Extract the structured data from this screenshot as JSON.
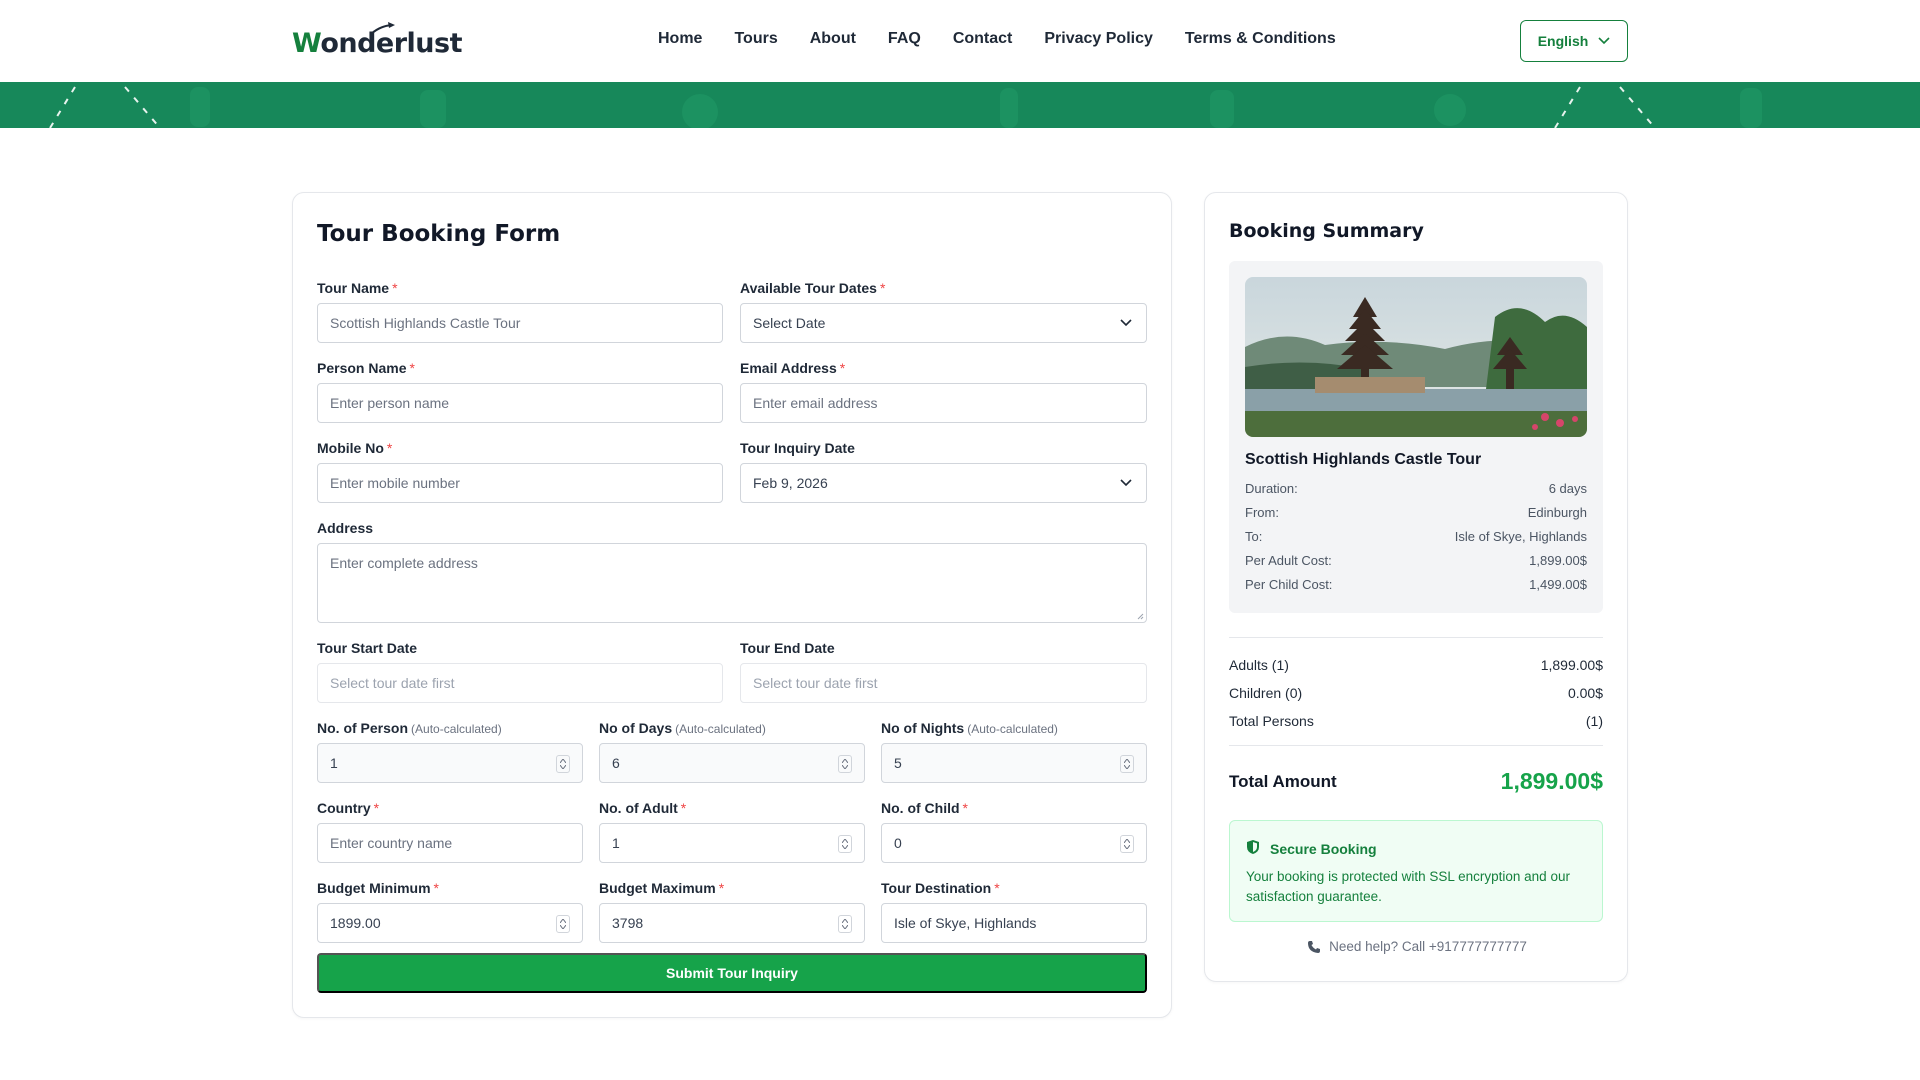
{
  "brand": {
    "logo_text": "Wonderlust",
    "accent": "#15803d"
  },
  "nav": {
    "items": [
      "Home",
      "Tours",
      "About",
      "FAQ",
      "Contact",
      "Privacy Policy",
      "Terms & Conditions"
    ]
  },
  "language": {
    "selected": "English"
  },
  "form": {
    "title": "Tour Booking Form",
    "tour_name": {
      "label": "Tour Name",
      "value": "Scottish Highlands Castle Tour"
    },
    "tour_dates": {
      "label": "Available Tour Dates",
      "value": "Select Date"
    },
    "person_name": {
      "label": "Person Name",
      "placeholder": "Enter person name"
    },
    "email": {
      "label": "Email Address",
      "placeholder": "Enter email address"
    },
    "mobile": {
      "label": "Mobile No",
      "placeholder": "Enter mobile number"
    },
    "inquiry_date": {
      "label": "Tour Inquiry Date",
      "value": "Feb 9, 2026"
    },
    "address": {
      "label": "Address",
      "placeholder": "Enter complete address"
    },
    "start_date": {
      "label": "Tour Start Date",
      "placeholder": "Select tour date first"
    },
    "end_date": {
      "label": "Tour End Date",
      "placeholder": "Select tour date first"
    },
    "num_person": {
      "label": "No. of Person",
      "hint": "(Auto-calculated)",
      "value": "1"
    },
    "num_days": {
      "label": "No of Days",
      "hint": "(Auto-calculated)",
      "value": "6"
    },
    "num_nights": {
      "label": "No of Nights",
      "hint": "(Auto-calculated)",
      "value": "5"
    },
    "country": {
      "label": "Country",
      "placeholder": "Enter country name"
    },
    "num_adult": {
      "label": "No. of Adult",
      "value": "1"
    },
    "num_child": {
      "label": "No. of Child",
      "value": "0"
    },
    "budget_min": {
      "label": "Budget Minimum",
      "value": "1899.00"
    },
    "budget_max": {
      "label": "Budget Maximum",
      "value": "3798"
    },
    "destination": {
      "label": "Tour Destination",
      "value": "Isle of Skye, Highlands"
    },
    "submit_label": "Submit Tour Inquiry"
  },
  "summary": {
    "title": "Booking Summary",
    "tour_name": "Scottish Highlands Castle Tour",
    "details": [
      {
        "k": "Duration:",
        "v": "6 days"
      },
      {
        "k": "From:",
        "v": "Edinburgh"
      },
      {
        "k": "To:",
        "v": "Isle of Skye, Highlands"
      },
      {
        "k": "Per Adult Cost:",
        "v": "1,899.00$"
      },
      {
        "k": "Per Child Cost:",
        "v": "1,499.00$"
      }
    ],
    "lines": [
      {
        "k": "Adults (1)",
        "v": "1,899.00$"
      },
      {
        "k": "Children (0)",
        "v": "0.00$"
      },
      {
        "k": "Total Persons",
        "v": "(1)"
      }
    ],
    "total_label": "Total Amount",
    "total_value": "1,899.00$",
    "secure_title": "Secure Booking",
    "secure_text": "Your booking is protected with SSL encryption and our satisfaction guarantee.",
    "help_text": "Need help? Call +917777777777"
  }
}
